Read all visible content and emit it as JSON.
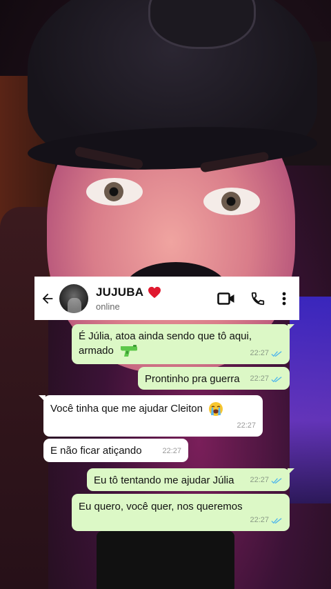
{
  "contact": {
    "name": "JUJUBA",
    "status": "online"
  },
  "icons": {
    "back": "arrow-left-icon",
    "avatar": "contact-avatar",
    "heart": "red-heart-emoji",
    "video": "video-camera-icon",
    "call": "phone-icon",
    "menu": "more-vertical-icon",
    "read_ticks": "double-check-icon",
    "pistol": "water-pistol-emoji",
    "cry": "loudly-crying-face-emoji"
  },
  "colors": {
    "outgoing_bubble": "#dcf8c6",
    "incoming_bubble": "#ffffff",
    "read_ticks": "#4fb6ec",
    "header_bg": "#ffffff"
  },
  "messages": [
    {
      "direction": "out",
      "text_line1": "É Júlia, atoa ainda sendo que tô aqui,",
      "text_line2": "armado",
      "time": "22:27",
      "read": true
    },
    {
      "direction": "out",
      "text": "Prontinho pra guerra",
      "time": "22:27",
      "read": true
    },
    {
      "direction": "in",
      "text": "Você tinha que me ajudar Cleiton",
      "time": "22:27"
    },
    {
      "direction": "in",
      "text": "E não ficar atiçando",
      "time": "22:27"
    },
    {
      "direction": "out",
      "text": "Eu tô tentando me ajudar Júlia",
      "time": "22:27",
      "read": true
    },
    {
      "direction": "out",
      "text": "Eu quero, você quer, nos queremos",
      "time": "22:27",
      "read": true
    }
  ]
}
